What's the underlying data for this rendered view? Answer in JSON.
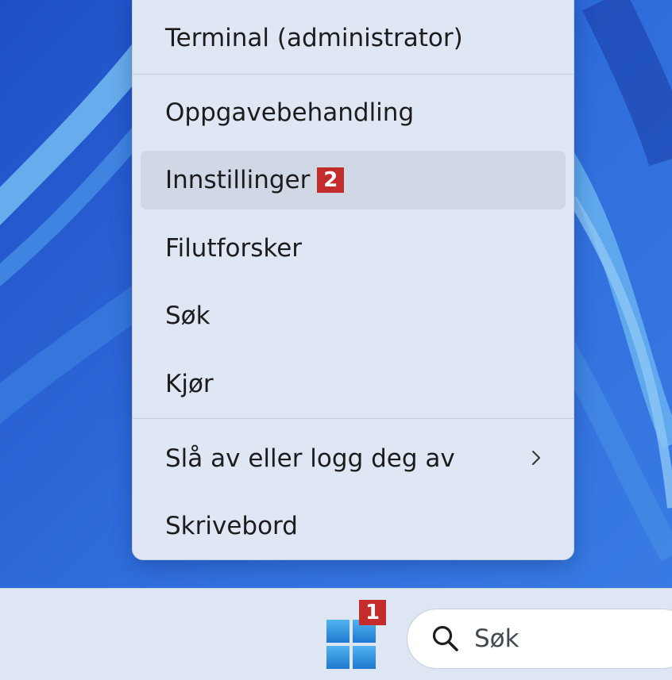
{
  "context_menu": {
    "items": [
      {
        "label": "Terminal (administrator)"
      },
      {
        "label": "Oppgavebehandling"
      },
      {
        "label": "Innstillinger",
        "callout": "2"
      },
      {
        "label": "Filutforsker"
      },
      {
        "label": "Søk"
      },
      {
        "label": "Kjør"
      },
      {
        "label": "Slå av eller logg deg av"
      },
      {
        "label": "Skrivebord"
      }
    ]
  },
  "taskbar": {
    "start_callout": "1",
    "search_placeholder": "Søk"
  },
  "colors": {
    "menu_background": "#dfe7f5",
    "callout": "#c42b2b",
    "wallpaper_blue": "#2c61d1",
    "start_logo": "#2e8fdb"
  },
  "icons": {
    "start": "windows-logo-icon",
    "search": "search-icon",
    "submenu": "chevron-right-icon"
  }
}
